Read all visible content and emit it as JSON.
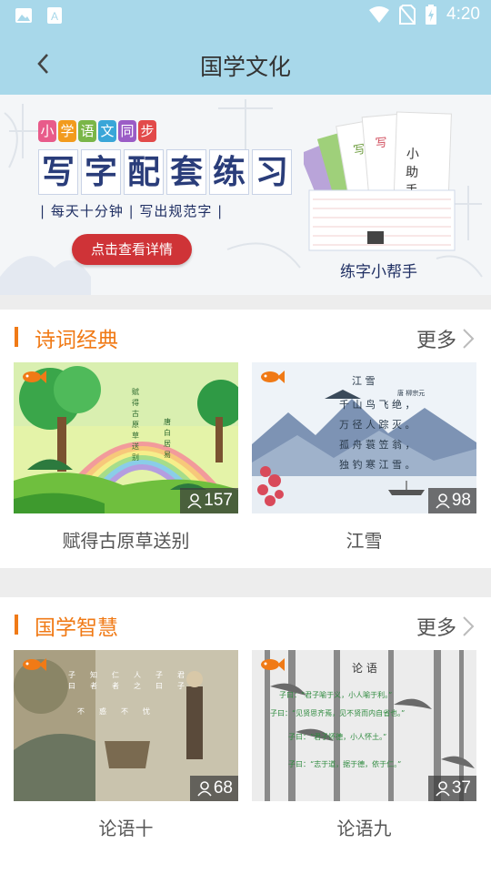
{
  "status_bar": {
    "time": "4:20"
  },
  "header": {
    "title": "国学文化"
  },
  "banner": {
    "top_chars": [
      "小",
      "学",
      "语",
      "文",
      "同",
      "步"
    ],
    "top_colors": [
      "#e85b8a",
      "#f29b1d",
      "#7ab648",
      "#3aa6d8",
      "#9b5cc6",
      "#e24a4a"
    ],
    "title_chars": [
      "写",
      "字",
      "配",
      "套",
      "练",
      "习"
    ],
    "slogan": "| 每天十分钟 | 写出规范字 |",
    "button_label": "点击查看详情",
    "helper": "练字小帮手"
  },
  "sections": [
    {
      "title": "诗词经典",
      "more_label": "更多",
      "cards": [
        {
          "caption": "赋得古原草送别",
          "views": "157"
        },
        {
          "caption": "江雪",
          "views": "98"
        }
      ]
    },
    {
      "title": "国学智慧",
      "more_label": "更多",
      "cards": [
        {
          "caption": "论语十",
          "views": "68"
        },
        {
          "caption": "论语九",
          "views": "37"
        }
      ]
    }
  ],
  "colors": {
    "accent": "#f07a16",
    "header_bg": "#a8d8ea",
    "button": "#cf3337"
  }
}
